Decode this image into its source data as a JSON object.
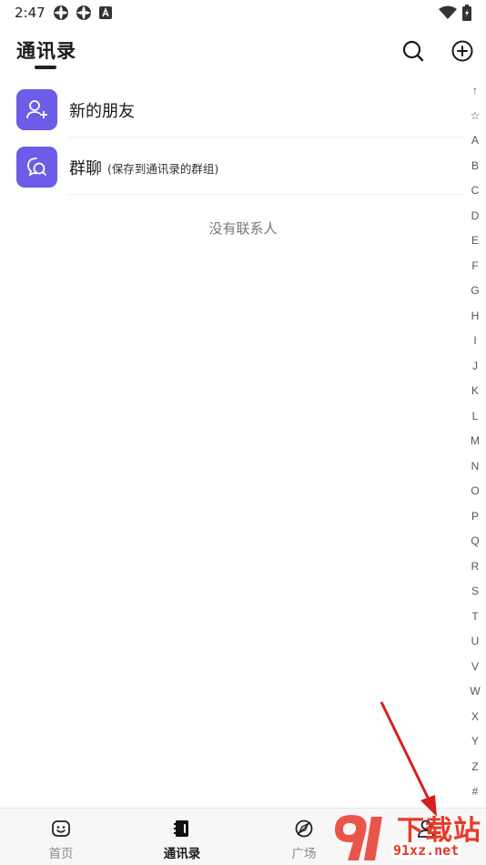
{
  "status_bar": {
    "time": "2:47"
  },
  "header": {
    "title": "通讯录"
  },
  "list": {
    "new_friends_label": "新的朋友",
    "group_chat_label": "群聊",
    "group_chat_note": "(保存到通讯录的群组)"
  },
  "empty_message": "没有联系人",
  "alpha_index": [
    "↑",
    "☆",
    "A",
    "B",
    "C",
    "D",
    "E",
    "F",
    "G",
    "H",
    "I",
    "J",
    "K",
    "L",
    "M",
    "N",
    "O",
    "P",
    "Q",
    "R",
    "S",
    "T",
    "U",
    "V",
    "W",
    "X",
    "Y",
    "Z",
    "#"
  ],
  "bottom_nav": {
    "items": [
      {
        "label": "首页",
        "icon": "smile-face-icon"
      },
      {
        "label": "通讯录",
        "icon": "contacts-book-icon",
        "active": true
      },
      {
        "label": "广场",
        "icon": "compass-icon"
      },
      {
        "label": "",
        "icon": "profile-icon"
      }
    ]
  },
  "watermark": {
    "logo_text": "下载站",
    "url_text": "91xz.net"
  },
  "colors": {
    "accent": "#6c5ce7",
    "arrow": "#d62020",
    "nav_bg": "#f7f7f7"
  }
}
